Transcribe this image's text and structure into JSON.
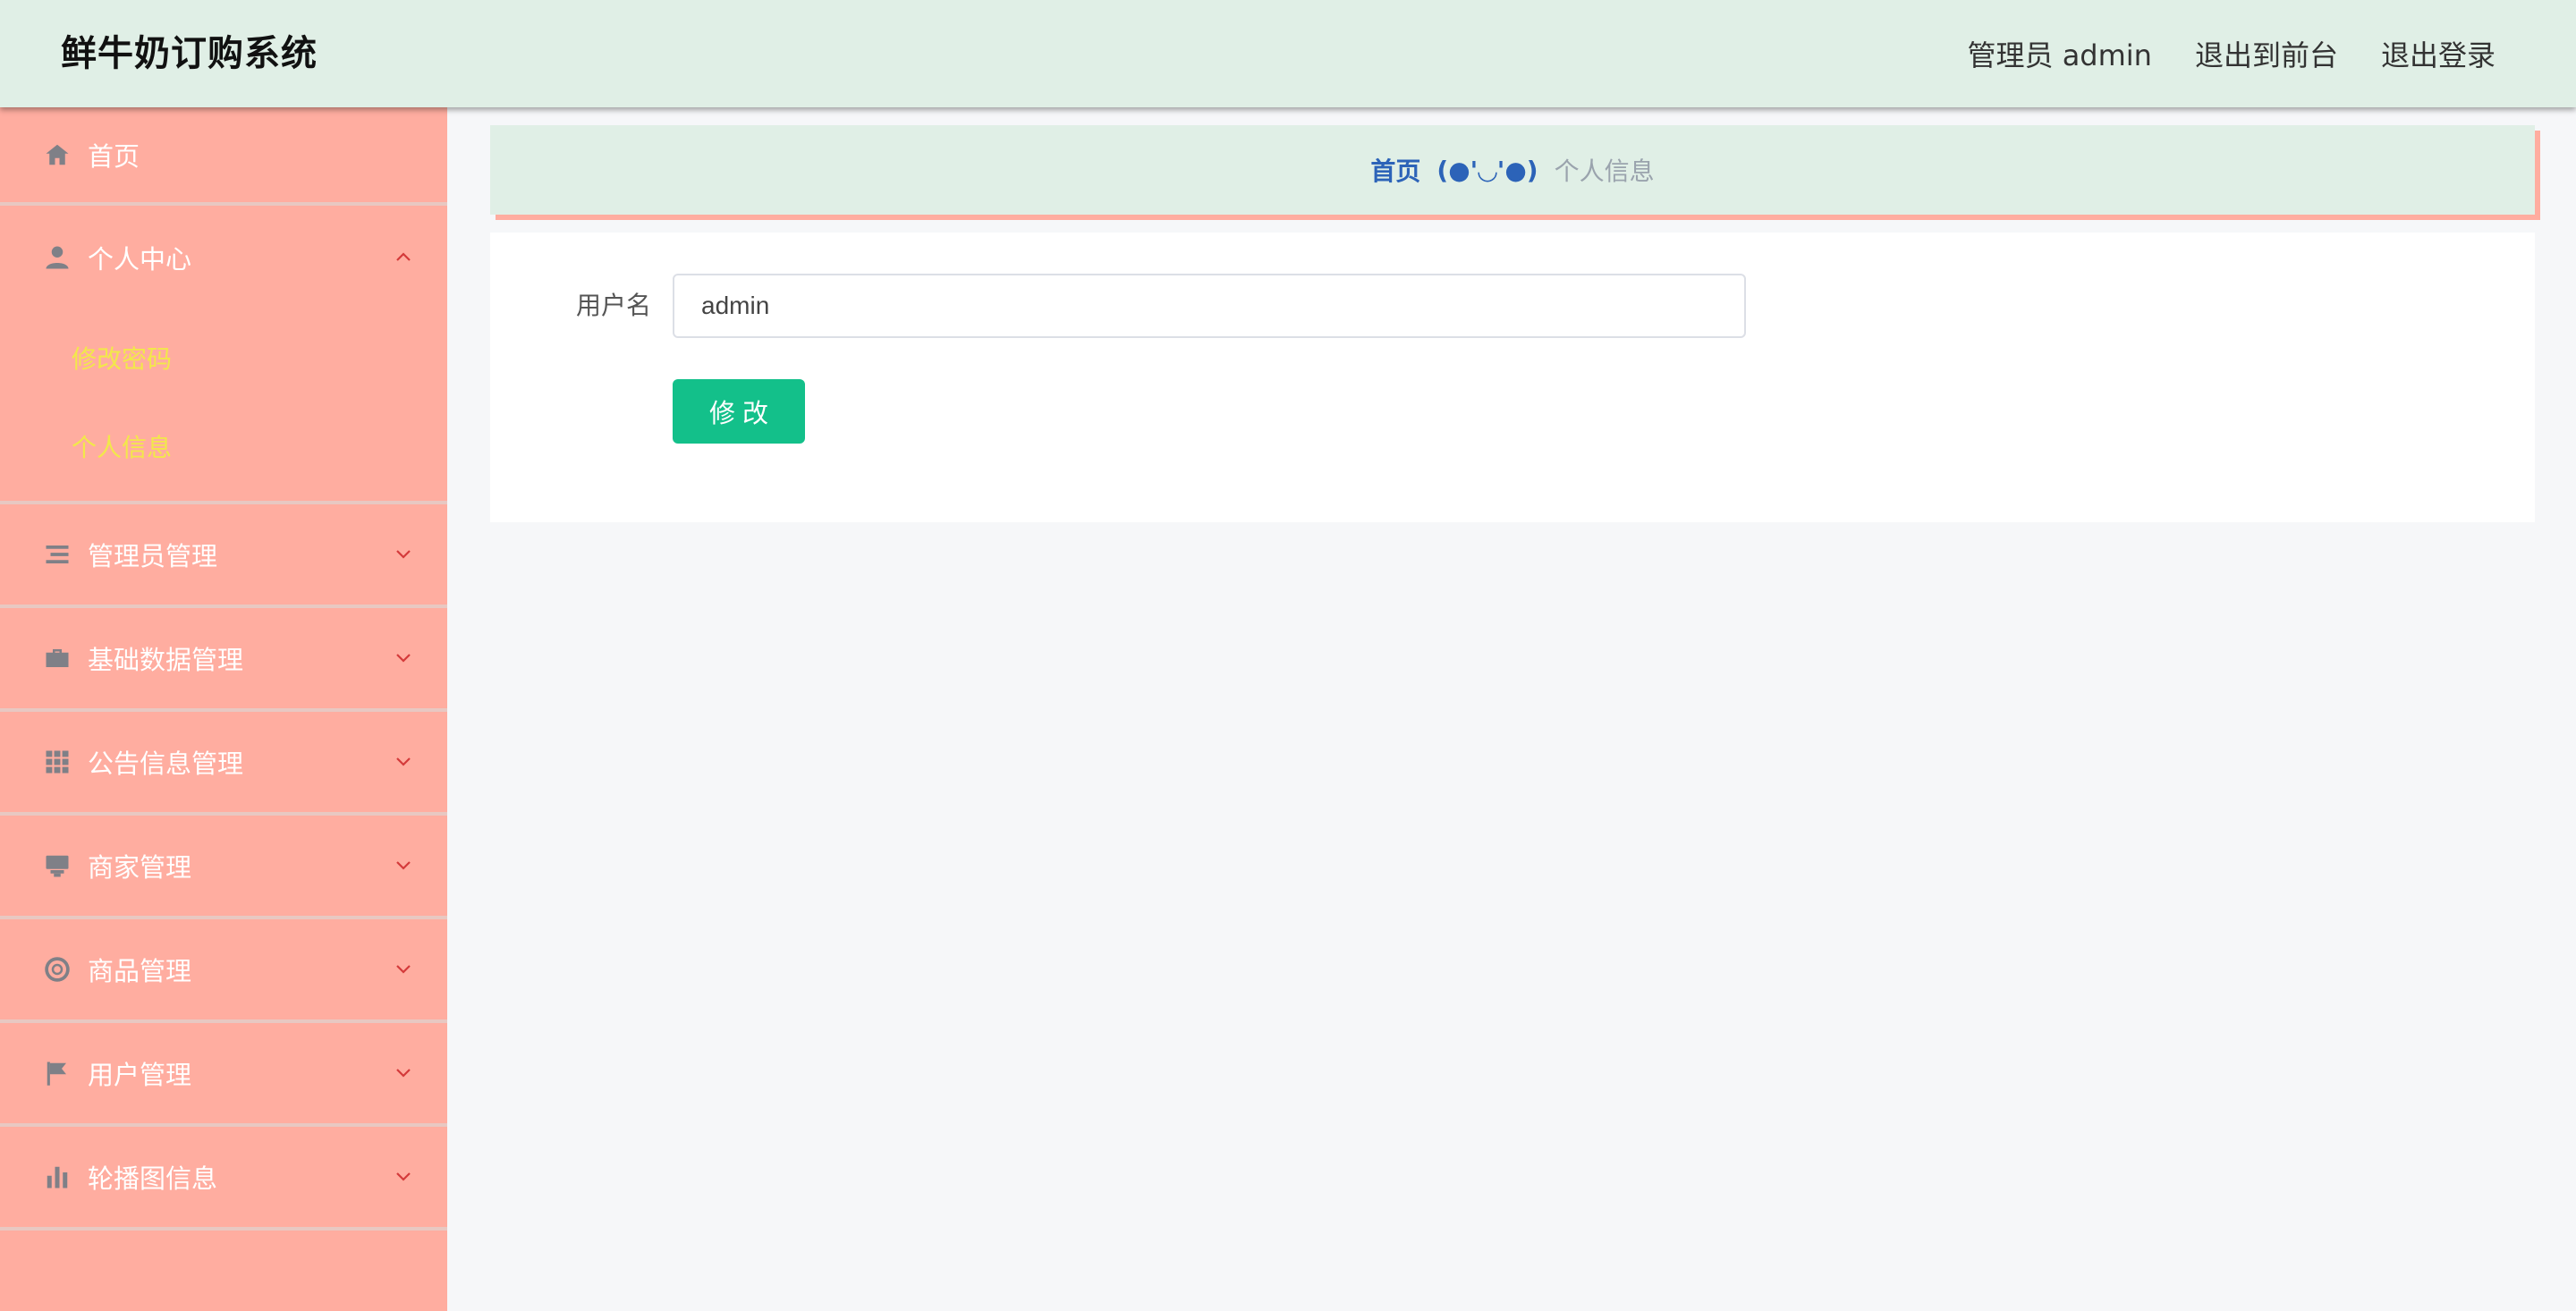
{
  "header": {
    "title": "鲜牛奶订购系统",
    "user_label": "管理员 admin",
    "to_front": "退出到前台",
    "logout": "退出登录"
  },
  "sidebar": {
    "items": [
      {
        "label": "首页",
        "icon": "home-icon"
      },
      {
        "label": "个人中心",
        "icon": "user-icon",
        "expanded": true,
        "children": [
          {
            "label": "修改密码"
          },
          {
            "label": "个人信息"
          }
        ]
      },
      {
        "label": "管理员管理",
        "icon": "list-icon"
      },
      {
        "label": "基础数据管理",
        "icon": "briefcase-icon"
      },
      {
        "label": "公告信息管理",
        "icon": "grid-icon"
      },
      {
        "label": "商家管理",
        "icon": "shop-icon"
      },
      {
        "label": "商品管理",
        "icon": "lifebuoy-icon"
      },
      {
        "label": "用户管理",
        "icon": "flag-icon"
      },
      {
        "label": "轮播图信息",
        "icon": "bar-chart-icon"
      }
    ]
  },
  "breadcrumb": {
    "home": "首页",
    "face": "(●'◡'●)",
    "current": "个人信息"
  },
  "form": {
    "username_label": "用户名",
    "username_value": "admin",
    "submit_label": "修改"
  },
  "colors": {
    "header_bg": "#e0efe6",
    "sidebar_bg": "#ffada0",
    "submenu_text": "#f2e84a",
    "button_bg": "#13c08a",
    "arrow": "#d43a3a"
  }
}
